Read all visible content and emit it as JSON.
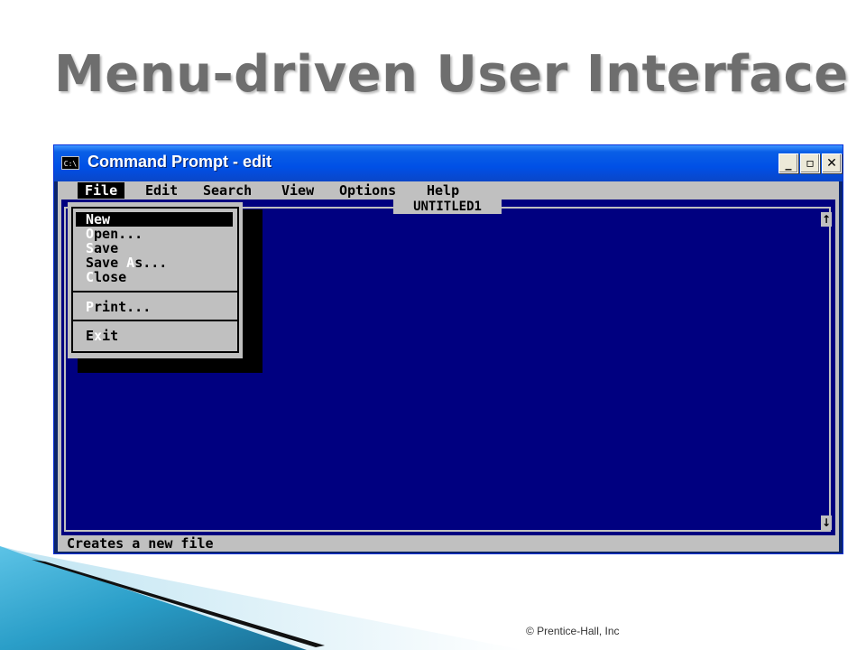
{
  "slide": {
    "title": "Menu-driven User Interface",
    "footer": "© Prentice-Hall, Inc"
  },
  "window": {
    "title": "Command Prompt - edit",
    "icon": "cmd-icon",
    "icon_label": "C:\\",
    "buttons": {
      "minimize": "_",
      "maximize": "▫",
      "close": "✕"
    }
  },
  "menubar": [
    "File",
    "Edit",
    "Search",
    "View",
    "Options",
    "Help"
  ],
  "editor": {
    "document_title": "UNTITLED1",
    "scroll_up": "↑",
    "scroll_down": "↓"
  },
  "file_menu": {
    "items": [
      {
        "hotkey": "N",
        "rest": "ew",
        "selected": true
      },
      {
        "hotkey": "O",
        "rest": "pen..."
      },
      {
        "hotkey": "S",
        "rest": "ave"
      },
      {
        "pre": "Save ",
        "hotkey": "A",
        "rest": "s..."
      },
      {
        "hotkey": "C",
        "rest": "lose"
      },
      {
        "hotkey": "P",
        "rest": "rint..."
      },
      {
        "pre": "E",
        "hotkey": "x",
        "rest": "it"
      }
    ]
  },
  "status": {
    "text": "Creates a new file"
  },
  "colors": {
    "editor_bg": "#000080",
    "chrome": "#c0c0c0",
    "titlebar": "#0050e6",
    "swoosh": "#2a9ec8"
  }
}
